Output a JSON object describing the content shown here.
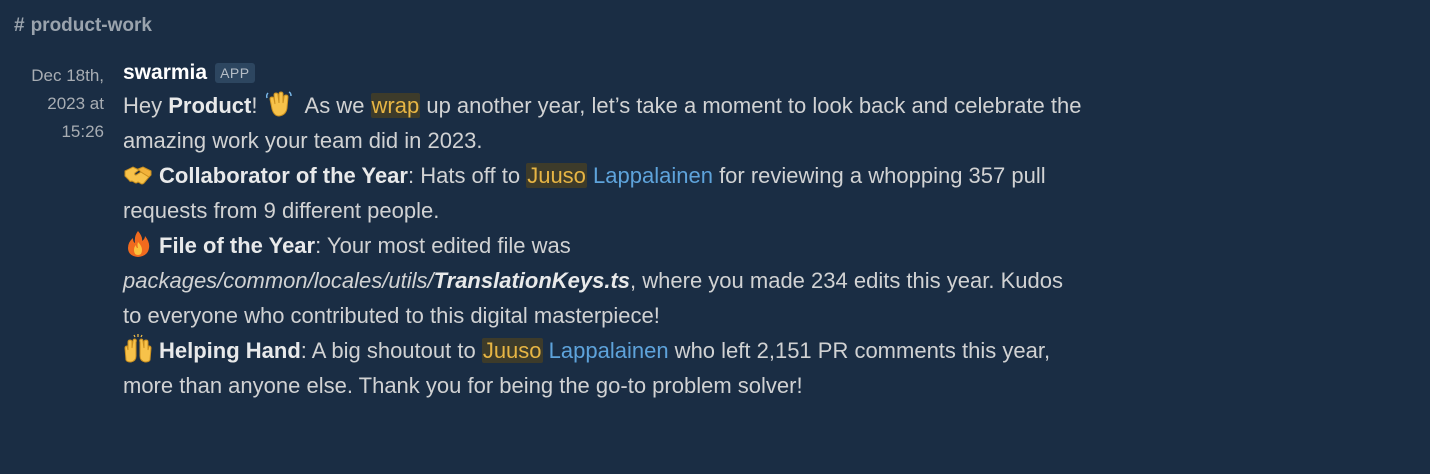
{
  "channel": {
    "hash": "#",
    "name": "product-work"
  },
  "message": {
    "timestamp": "Dec 18th, 2023 at 15:26",
    "author": "swarmia",
    "badge": "APP",
    "intro": {
      "greeting": "Hey ",
      "team": "Product",
      "after_team": "!",
      "text1": " As we ",
      "wrap": "wrap",
      "text2": " up another year, let’s take a moment to look back and celebrate the amazing work your team did in 2023."
    },
    "collaborator": {
      "emoji": "handshake-icon",
      "title": "Collaborator of the Year",
      "text1": ": Hats off to ",
      "first_name": "Juuso",
      "last_name": "Lappalainen",
      "text2": " for reviewing a whopping 357 pull requests from 9 different people."
    },
    "file": {
      "emoji": "fire-icon",
      "title": "File of the Year",
      "text1": ": Your most edited file was ",
      "path": "packages/common/locales/utils/",
      "filename": "TranslationKeys.ts",
      "text2": ", where you made 234 edits this year. Kudos to everyone who contributed to this digital masterpiece!"
    },
    "helping": {
      "emoji": "raised-hands-icon",
      "title": "Helping Hand",
      "text1": ": A big shoutout to ",
      "first_name": "Juuso",
      "last_name": "Lappalainen",
      "text2": " who left 2,151 PR comments this year, more than anyone else. Thank you for being the go-to problem solver!"
    }
  },
  "colors": {
    "background": "#1a2d44",
    "text": "#d1d2d3",
    "highlight": "#e7b544",
    "link": "#5ea3db"
  }
}
